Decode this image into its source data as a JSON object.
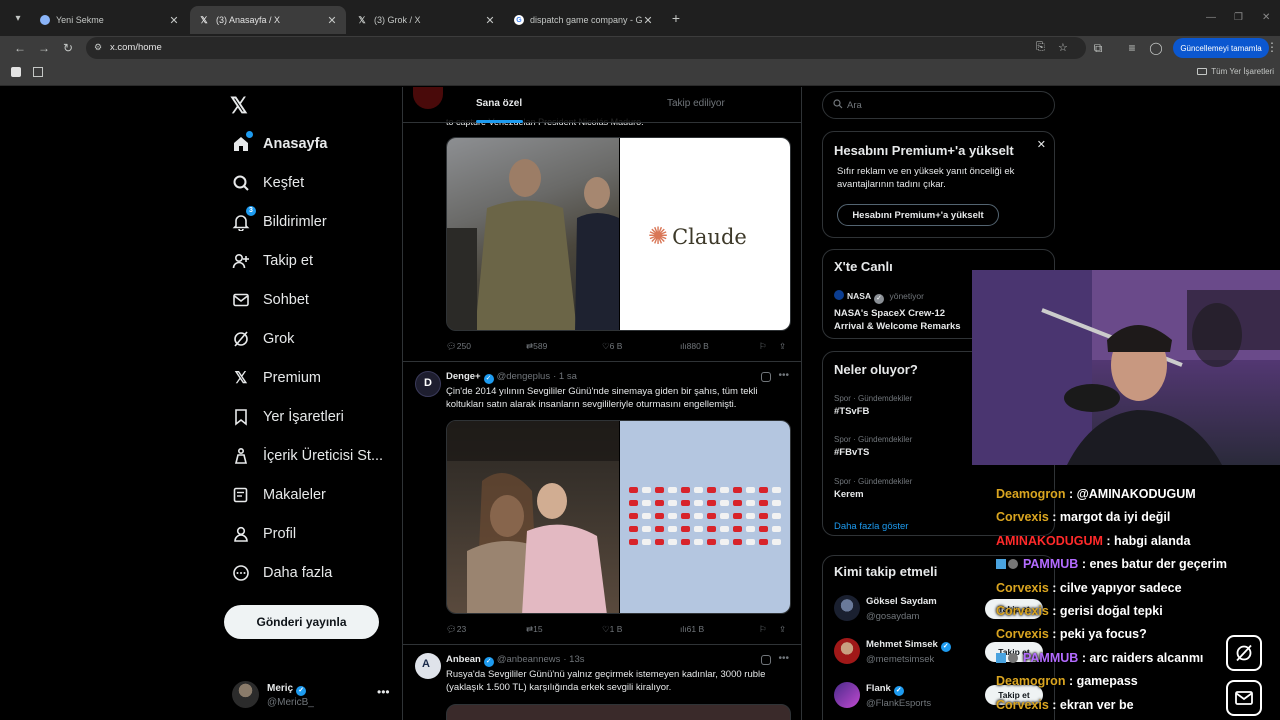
{
  "browser": {
    "tabs": [
      {
        "title": "Yeni Sekme",
        "favicon": "chrome-icon"
      },
      {
        "title": "(3) Anasayfa / X",
        "favicon": "x-icon"
      },
      {
        "title": "(3) Grok / X",
        "favicon": "x-icon"
      },
      {
        "title": "dispatch game company - Goo",
        "favicon": "google-icon"
      }
    ],
    "url": "x.com/home",
    "update_button": "Güncellemeyi tamamla",
    "bookmarks_all": "Tüm Yer İşaretleri"
  },
  "nav": {
    "items": [
      {
        "label": "Anasayfa",
        "icon": "home-icon"
      },
      {
        "label": "Keşfet",
        "icon": "search-icon"
      },
      {
        "label": "Bildirimler",
        "icon": "bell-icon",
        "badge": "3"
      },
      {
        "label": "Takip et",
        "icon": "follow-icon"
      },
      {
        "label": "Sohbet",
        "icon": "mail-icon"
      },
      {
        "label": "Grok",
        "icon": "grok-icon"
      },
      {
        "label": "Premium",
        "icon": "x-icon"
      },
      {
        "label": "Yer İşaretleri",
        "icon": "bookmark-icon"
      },
      {
        "label": "İçerik Üreticisi St...",
        "icon": "creator-icon"
      },
      {
        "label": "Makaleler",
        "icon": "article-icon"
      },
      {
        "label": "Profil",
        "icon": "profile-icon"
      },
      {
        "label": "Daha fazla",
        "icon": "more-icon"
      }
    ],
    "post_button": "Gönderi yayınla",
    "account": {
      "name": "Meriç",
      "handle": "@MericB_"
    }
  },
  "feed": {
    "tabs": [
      "Sana özel",
      "Takip ediliyor"
    ],
    "cut_text": "to capture Venezuelan President Nicolás Maduro.",
    "claude_logo": "Claude",
    "tweets": [
      {
        "stats": {
          "replies": "250",
          "retweets": "589",
          "likes": "6 B",
          "views": "880 B"
        }
      },
      {
        "name": "Denge+",
        "handle": "@dengeplus",
        "time": "· 1 sa",
        "text": "Çin'de 2014 yılının Sevgililer Günü'nde sinemaya giden bir şahıs, tüm tekli koltukları satın alarak insanların sevgilileriyle oturmasını engellemişti.",
        "stats": {
          "replies": "23",
          "retweets": "15",
          "likes": "1 B",
          "views": "61 B"
        }
      },
      {
        "name": "Anbean",
        "handle": "@anbeannews",
        "time": "· 13s",
        "text": "Rusya'da Sevgililer Günü'nü yalnız geçirmek istemeyen kadınlar, 3000 ruble (yaklaşık 1.500 TL) karşılığında erkek sevgili kiralıyor."
      }
    ]
  },
  "right": {
    "search_placeholder": "Ara",
    "premium": {
      "title": "Hesabını Premium+'a yükselt",
      "text": "Sıfır reklam ve en yüksek yanıt önceliği ek avantajlarının tadını çıkar.",
      "button": "Hesabını Premium+'a yükselt"
    },
    "live": {
      "title": "X'te Canlı",
      "host": "NASA",
      "role": "yönetiyor",
      "event": "NASA's SpaceX Crew-12 Arrival & Welcome Remarks"
    },
    "trends": {
      "title": "Neler oluyor?",
      "items": [
        {
          "category": "Spor · Gündemdekiler",
          "tag": "#TSvFB"
        },
        {
          "category": "Spor · Gündemdekiler",
          "tag": "#FBvTS"
        },
        {
          "category": "Spor · Gündemdekiler",
          "tag": "Kerem"
        }
      ],
      "show_more": "Daha fazla göster"
    },
    "who_to_follow": {
      "title": "Kimi takip etmeli",
      "users": [
        {
          "name": "Göksel Saydam",
          "handle": "@gosaydam"
        },
        {
          "name": "Mehmet Simsek",
          "handle": "@memetsimsek"
        },
        {
          "name": "Flank",
          "handle": "@FlankEsports"
        }
      ],
      "follow_label": "Takip et"
    }
  },
  "stream": {
    "chat": [
      {
        "user": "Deamogron",
        "color": "#daa520",
        "msg": ": @AMINAKODUGUM"
      },
      {
        "user": "Corvexis",
        "color": "#daa520",
        "msg": ": margot da iyi değil"
      },
      {
        "user": "AMINAKODUGUM",
        "color": "#ff2a2a",
        "msg": ": habgi alanda"
      },
      {
        "user": "PAMMUB",
        "color": "#b36bff",
        "msg": ": enes batur der geçerim"
      },
      {
        "user": "Corvexis",
        "color": "#daa520",
        "msg": ": cilve yapıyor sadece"
      },
      {
        "user": "Corvexis",
        "color": "#daa520",
        "msg": ": gerisi doğal tepki"
      },
      {
        "user": "Corvexis",
        "color": "#daa520",
        "msg": ": peki ya focus?"
      },
      {
        "user": "PAMMUB",
        "color": "#b36bff",
        "msg": ": arc raiders alcanmı"
      },
      {
        "user": "Deamogron",
        "color": "#daa520",
        "msg": ": gamepass"
      },
      {
        "user": "Corvexis",
        "color": "#daa520",
        "msg": ": ekran ver be"
      }
    ]
  }
}
